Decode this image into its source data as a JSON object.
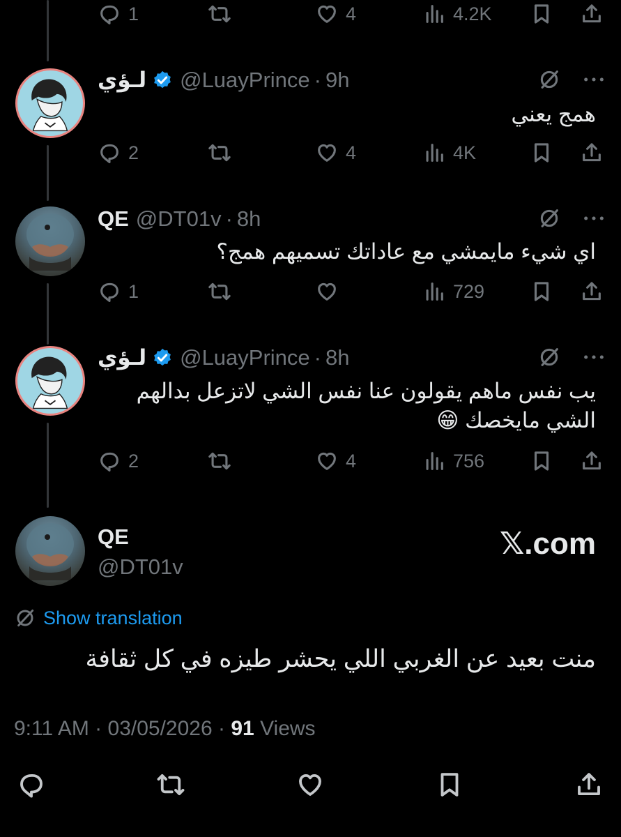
{
  "top_actions": {
    "replies": "1",
    "reposts": "",
    "likes": "4",
    "views": "4.2K"
  },
  "tweets": [
    {
      "name": "لـؤي",
      "handle": "@LuayPrince",
      "time": "9h",
      "text": "همج يعني",
      "replies": "2",
      "reposts": "",
      "likes": "4",
      "views": "4K"
    },
    {
      "name": "QE",
      "handle": "@DT01v",
      "time": "8h",
      "text": "اي شيء مايمشي مع عاداتك تسميهم همج؟",
      "replies": "1",
      "reposts": "",
      "likes": "",
      "views": "729"
    },
    {
      "name": "لـؤي",
      "handle": "@LuayPrince",
      "time": "8h",
      "text_line1": "يب نفس ماهم يقولون عنا نفس الشي لاتزعل بدالهم",
      "text_line2": "الشي مايخصك 😁",
      "replies": "2",
      "reposts": "",
      "likes": "4",
      "views": "756"
    }
  ],
  "main_tweet": {
    "name": "QE",
    "handle": "@DT01v",
    "source_label": "𝕏.com",
    "show_translation": "Show translation",
    "text": "منت بعيد عن الغربي اللي يحشر طيزه في كل ثقافة",
    "time": "9:11 AM",
    "date": "03/05/2026",
    "views_count": "91",
    "views_label": "Views"
  },
  "colors": {
    "background": "#000000",
    "text": "#e7e9ea",
    "secondary": "#71767b",
    "link": "#1d9bf0",
    "verified": "#1d9bf0"
  }
}
